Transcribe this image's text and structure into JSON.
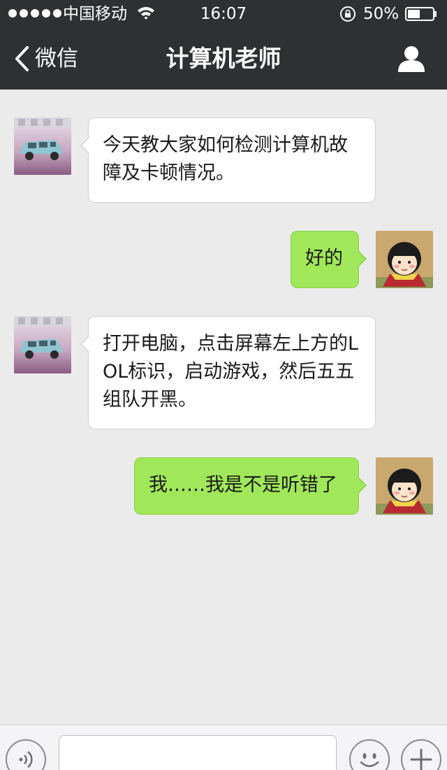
{
  "status_bar": {
    "carrier": "中国移动",
    "time": "16:07",
    "battery_percent": "50%",
    "battery_level": 0.5,
    "signal_dots": 5
  },
  "nav": {
    "back_label": "微信",
    "title": "计算机老师"
  },
  "messages": [
    {
      "side": "in",
      "text": "今天教大家如何检测计算机故障及卡顿情况。"
    },
    {
      "side": "out",
      "text": "好的"
    },
    {
      "side": "in",
      "text": "打开电脑，点击屏幕左上方的LOL标识，启动游戏，然后五五组队开黑。"
    },
    {
      "side": "out",
      "text": "我……我是不是听错了"
    }
  ],
  "input": {
    "value": "",
    "placeholder": ""
  },
  "colors": {
    "header_bg": "#2e3132",
    "chat_bg": "#ebebeb",
    "outgoing_bubble": "#a0e75a",
    "incoming_bubble": "#ffffff"
  },
  "icons": [
    "signal-dots-icon",
    "wifi-icon",
    "rotation-lock-icon",
    "battery-icon",
    "chevron-left-icon",
    "profile-icon",
    "voice-icon",
    "emoji-icon",
    "plus-icon"
  ]
}
